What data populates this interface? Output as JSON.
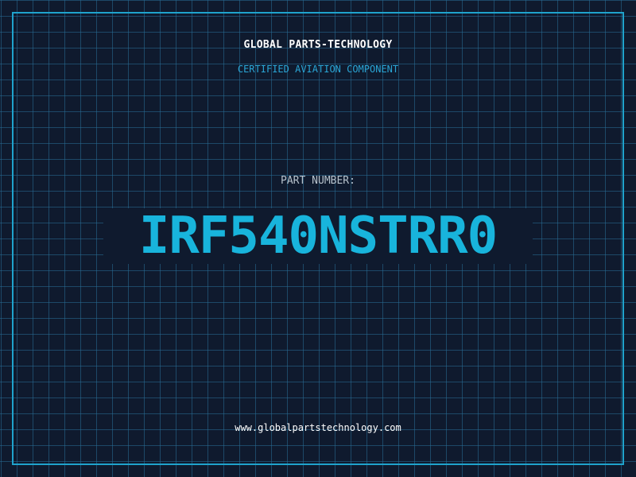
{
  "header": {
    "company": "GLOBAL PARTS-TECHNOLOGY",
    "certification": "CERTIFIED AVIATION COMPONENT"
  },
  "part": {
    "label": "PART NUMBER:",
    "number": "IRF540NSTRR0"
  },
  "footer": {
    "website": "www.globalpartstechnology.com"
  },
  "colors": {
    "background": "#0f1a2e",
    "grid": "#286e96",
    "accent": "#18b4dc",
    "frame": "#1fa3cc"
  }
}
